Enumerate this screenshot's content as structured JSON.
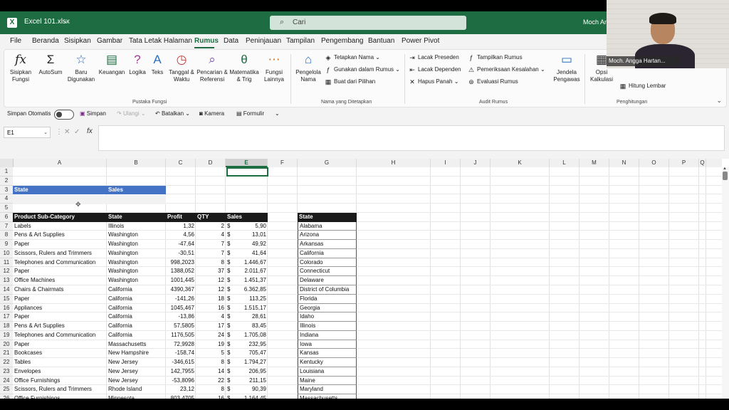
{
  "titlebar": {
    "filename": "Excel 101.xlsx",
    "search_placeholder": "Cari",
    "user_name": "Moch Ang"
  },
  "menu": [
    "File",
    "Beranda",
    "Sisipkan",
    "Gambar",
    "Tata Letak Halaman",
    "Rumus",
    "Data",
    "Peninjauan",
    "Tampilan",
    "Pengembang",
    "Bantuan",
    "Power Pivot"
  ],
  "menu_active": "Rumus",
  "ribbon": {
    "pustaka": {
      "label": "Pustaka Fungsi",
      "buttons": [
        {
          "l1": "Sisipkan",
          "l2": "Fungsi",
          "icon": "fx-icon"
        },
        {
          "l1": "AutoSum",
          "l2": "",
          "icon": "sigma-icon"
        },
        {
          "l1": "Baru",
          "l2": "Digunakan",
          "icon": "star-icon"
        },
        {
          "l1": "Keuangan",
          "l2": "",
          "icon": "database-icon"
        },
        {
          "l1": "Logika",
          "l2": "",
          "icon": "question-icon"
        },
        {
          "l1": "Teks",
          "l2": "",
          "icon": "text-icon"
        },
        {
          "l1": "Tanggal &",
          "l2": "Waktu",
          "icon": "clock-icon"
        },
        {
          "l1": "Pencarian &",
          "l2": "Referensi",
          "icon": "search-ref-icon"
        },
        {
          "l1": "Matematika",
          "l2": "& Trig",
          "icon": "theta-icon"
        },
        {
          "l1": "Fungsi",
          "l2": "Lainnya",
          "icon": "more-functions-icon"
        }
      ]
    },
    "nama": {
      "label": "Nama yang Ditetapkan",
      "manager": {
        "l1": "Pengelola",
        "l2": "Nama"
      },
      "items": [
        "Tetapkan Nama",
        "Gunakan dalam Rumus",
        "Buat dari Pilihan"
      ]
    },
    "audit": {
      "label": "Audit Rumus",
      "left": [
        "Lacak Preseden",
        "Lacak Dependen",
        "Hapus Panah"
      ],
      "right": [
        "Tampilkan Rumus",
        "Pemeriksaan Kesalahan",
        "Evaluasi Rumus"
      ],
      "watch": {
        "l1": "Jendela",
        "l2": "Pengawas"
      }
    },
    "hitung": {
      "label": "Penghitungan",
      "options": {
        "l1": "Opsi",
        "l2": "Kalkulasi"
      },
      "sheet": "Hitung Lembar"
    }
  },
  "qat": {
    "autosave": "Simpan Otomatis",
    "save": "Simpan",
    "redo": "Ulangi",
    "undo": "Batalkan",
    "camera": "Kamera",
    "formula": "Formulir"
  },
  "formula_bar": {
    "namebox": "E1",
    "fx": "fx"
  },
  "grid": {
    "columns": [
      "A",
      "B",
      "C",
      "D",
      "E",
      "F",
      "G",
      "H",
      "I",
      "J",
      "K",
      "L",
      "M",
      "N",
      "O",
      "P",
      "Q"
    ],
    "selected_col": "E",
    "rows": [
      "1",
      "2",
      "3",
      "4",
      "5",
      "6",
      "7",
      "8",
      "9",
      "10",
      "11",
      "12",
      "13",
      "14",
      "15",
      "16",
      "17",
      "18",
      "19",
      "20",
      "21",
      "22",
      "23",
      "24",
      "25",
      "26"
    ],
    "criteria_headers": [
      "State",
      "Sales"
    ],
    "table_headers": [
      "Product Sub-Category",
      "State",
      "Profit",
      "QTY",
      "Sales"
    ],
    "currency": "$",
    "table_rows": [
      [
        "Labels",
        "Illinois",
        "1,32",
        "2",
        "5,90"
      ],
      [
        "Pens & Art Supplies",
        "Washington",
        "4,56",
        "4",
        "13,01"
      ],
      [
        "Paper",
        "Washington",
        "-47,64",
        "7",
        "49,92"
      ],
      [
        "Scissors, Rulers and Trimmers",
        "Washington",
        "-30,51",
        "7",
        "41,64"
      ],
      [
        "Telephones and Communication",
        "Washington",
        "998,2023",
        "8",
        "1.446,67"
      ],
      [
        "Paper",
        "Washington",
        "1388,052",
        "37",
        "2.011,67"
      ],
      [
        "Office Machines",
        "Washington",
        "1001,445",
        "12",
        "1.451,37"
      ],
      [
        "Chairs & Chairmats",
        "California",
        "4390,367",
        "12",
        "6.362,85"
      ],
      [
        "Paper",
        "California",
        "-141,26",
        "18",
        "113,25"
      ],
      [
        "Appliances",
        "California",
        "1045,467",
        "16",
        "1.515,17"
      ],
      [
        "Paper",
        "California",
        "-13,86",
        "4",
        "28,61"
      ],
      [
        "Pens & Art Supplies",
        "California",
        "57,5805",
        "17",
        "83,45"
      ],
      [
        "Telephones and Communication",
        "California",
        "1176,505",
        "24",
        "1.705,08"
      ],
      [
        "Paper",
        "Massachusetts",
        "72,9928",
        "19",
        "232,95"
      ],
      [
        "Bookcases",
        "New Hampshire",
        "-158,74",
        "5",
        "705,47"
      ],
      [
        "Tables",
        "New Jersey",
        "-346,615",
        "8",
        "1.794,27"
      ],
      [
        "Envelopes",
        "New Jersey",
        "142,7955",
        "14",
        "206,95"
      ],
      [
        "Office Furnishings",
        "New Jersey",
        "-53,8096",
        "22",
        "211,15"
      ],
      [
        "Scissors, Rulers and Trimmers",
        "Rhode Island",
        "23,12",
        "8",
        "90,39"
      ],
      [
        "Office Furnishings",
        "Minnesota",
        "803,4705",
        "16",
        "1.164,45"
      ]
    ],
    "state_list_header": "State",
    "state_list": [
      "Alabama",
      "Arizona",
      "Arkansas",
      "California",
      "Colorado",
      "Connecticut",
      "Delaware",
      "District of Columbia",
      "Florida",
      "Georgia",
      "Idaho",
      "Illinois",
      "Indiana",
      "Iowa",
      "Kansas",
      "Kentucky",
      "Louisiana",
      "Maine",
      "Maryland",
      "Massachusetts"
    ]
  },
  "webcam": {
    "name": "Moch. Angga Hartan..."
  }
}
